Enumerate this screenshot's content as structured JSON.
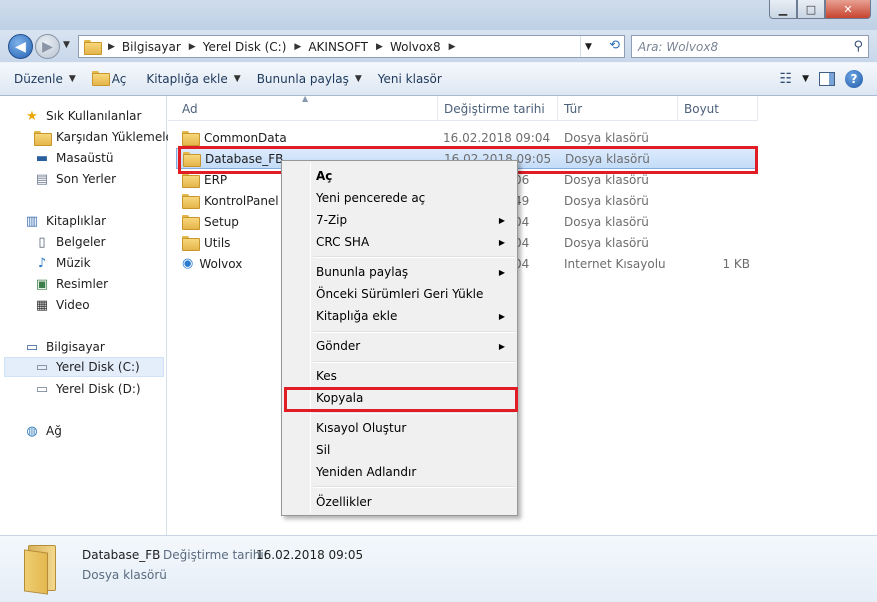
{
  "window": {
    "minimize_glyph": "▁",
    "maximize_glyph": "□",
    "close_glyph": "✕"
  },
  "address": {
    "crumbs": [
      "Bilgisayar",
      "Yerel Disk (C:)",
      "AKINSOFT",
      "Wolvox8"
    ],
    "search_placeholder": "Ara: Wolvox8"
  },
  "toolbar": {
    "organize": "Düzenle",
    "open": "Aç",
    "include_library": "Kitaplığa ekle",
    "share_with": "Bununla paylaş",
    "new_folder": "Yeni klasör"
  },
  "sidebar": {
    "favorites_header": "Sık Kullanılanlar",
    "favorites": [
      "Karşıdan Yüklemeler",
      "Masaüstü",
      "Son Yerler"
    ],
    "libraries_header": "Kitaplıklar",
    "libraries": [
      "Belgeler",
      "Müzik",
      "Resimler",
      "Video"
    ],
    "computer_header": "Bilgisayar",
    "drives": [
      "Yerel Disk (C:)",
      "Yerel Disk (D:)"
    ],
    "network": "Ağ"
  },
  "columns": {
    "name": "Ad",
    "modified": "Değiştirme tarihi",
    "type": "Tür",
    "size": "Boyut"
  },
  "files": [
    {
      "name": "CommonData",
      "date": "16.02.2018 09:04",
      "type": "Dosya klasörü",
      "size": ""
    },
    {
      "name": "Database_FB",
      "date": "16.02.2018 09:05",
      "type": "Dosya klasörü",
      "size": ""
    },
    {
      "name": "ERP",
      "date": "06",
      "type": "Dosya klasörü",
      "size": ""
    },
    {
      "name": "KontrolPanel",
      "date": "49",
      "type": "Dosya klasörü",
      "size": ""
    },
    {
      "name": "Setup",
      "date": "04",
      "type": "Dosya klasörü",
      "size": ""
    },
    {
      "name": "Utils",
      "date": "04",
      "type": "Dosya klasörü",
      "size": ""
    },
    {
      "name": "Wolvox",
      "date": "04",
      "type": "Internet Kısayolu",
      "size": "1 KB"
    }
  ],
  "context_menu": {
    "open": "Aç",
    "open_new_window": "Yeni pencerede aç",
    "zip": "7-Zip",
    "crc": "CRC SHA",
    "share_with": "Bununla paylaş",
    "restore": "Önceki Sürümleri Geri Yükle",
    "include_library": "Kitaplığa ekle",
    "send_to": "Gönder",
    "cut": "Kes",
    "copy": "Kopyala",
    "create_shortcut": "Kısayol Oluştur",
    "delete": "Sil",
    "rename": "Yeniden Adlandır",
    "properties": "Özellikler"
  },
  "details": {
    "name": "Database_FB",
    "modified_label": "Değiştirme tarihi:",
    "modified_value": "16.02.2018 09:05",
    "type": "Dosya klasörü"
  },
  "colors": {
    "highlight_red": "#e01c25",
    "selection_blue": "#c4dcf8"
  }
}
